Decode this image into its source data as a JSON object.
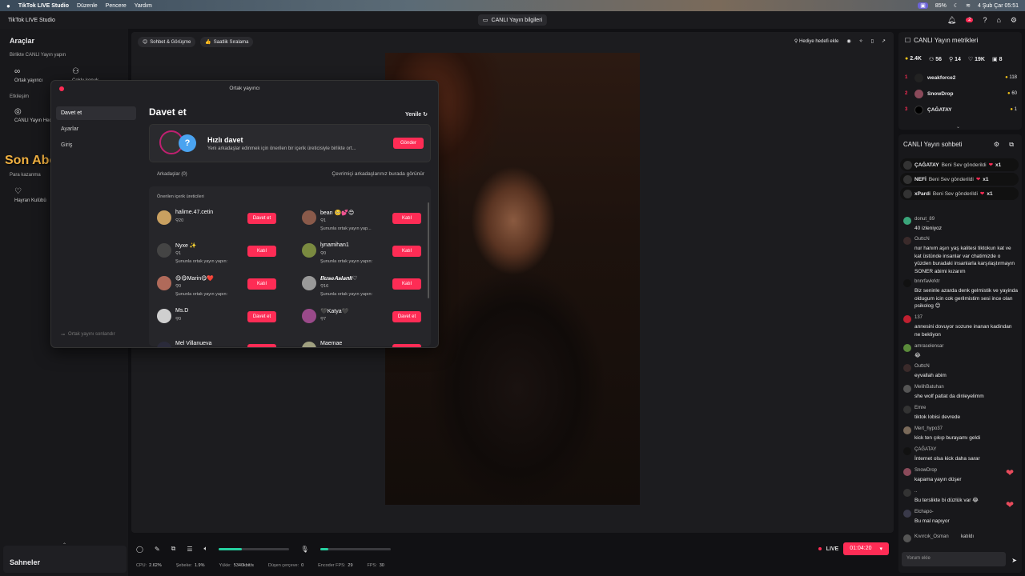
{
  "menubar": {
    "app": "TikTok LIVE Studio",
    "menus": [
      "Düzenle",
      "Pencere",
      "Yardım"
    ],
    "battery": "85%",
    "datetime": "4 Şub Çar  05:51"
  },
  "titlebar": {
    "window_title": "TikTok LIVE Studio",
    "center": "CANLI Yayın bilgileri",
    "notif_count": "2"
  },
  "sidebar": {
    "title": "Araçlar",
    "section1": "Birlikte CANLI Yayın yapın",
    "tool_ortak": "Ortak yayıncı",
    "tool_coklu": "Çoklu konuk",
    "section2": "Etkileşim",
    "tool_canli": "CANLI Yayın Hedefi",
    "section3": "Para kazanma",
    "tool_hayran": "Hayran Kulübü",
    "scenes": "Sahneler"
  },
  "stage": {
    "chip1": "Sohbet & Görüşme",
    "chip2": "Saatlik Sıralama",
    "gift_goal": "Hediye hedefi ekle"
  },
  "overlay": {
    "text": "Son Abone: nicetrydiddyverynice"
  },
  "dialog": {
    "title": "Ortak yayıncı",
    "nav": [
      "Davet et",
      "Ayarlar",
      "Giriş"
    ],
    "footer": "Ortak yayını sonlandır",
    "heading": "Davet et",
    "refresh": "Yenile",
    "quick_title": "Hızlı davet",
    "quick_desc": "Yeni arkadaşlar edinmek için önerilen bir içerik üreticisiyle birlikte ort...",
    "quick_btn": "Gönder",
    "friends_label": "Arkadaşlar (0)",
    "friends_online": "Çevrimiçi arkadaşlarınız burada görünür",
    "suggest_header": "Önerilen içerik üreticileri",
    "creators": [
      {
        "name": "halime.47.cetin",
        "count": "20",
        "sub": "",
        "btn": "Davet et",
        "color": "#c9a060"
      },
      {
        "name": "bean 🥺💕😊",
        "count": "1",
        "sub": "Şununla ortak yayın yap...",
        "btn": "Katıl",
        "color": "#8a5a4a"
      },
      {
        "name": "Nyxe ✨",
        "count": "1",
        "sub": "Şununla ortak yayın yapın:",
        "btn": "Katıl",
        "color": "#444"
      },
      {
        "name": "lynamihan1",
        "count": "0",
        "sub": "Şununla ortak yayın yapın:",
        "btn": "Katıl",
        "color": "#7a8a40"
      },
      {
        "name": "😋😋Marin😋❤️",
        "count": "0",
        "sub": "Şununla ortak yayın yapın:",
        "btn": "Katıl",
        "color": "#b06a5a"
      },
      {
        "name": "𝑩𝒖𝒔𝒆𝑨𝒔𝒍𝒂𝒏𝒍𝒊♡",
        "count": "16",
        "sub": "Şununla ortak yayın yapın:",
        "btn": "Katıl",
        "color": "#999"
      },
      {
        "name": "Ms.D",
        "count": "0",
        "sub": "",
        "btn": "Davet et",
        "color": "#cfcfcf"
      },
      {
        "name": "🖤Katya🖤",
        "count": "7",
        "sub": "",
        "btn": "Davet et",
        "color": "#9a4a8a"
      },
      {
        "name": "Mel Villanueva",
        "count": "0",
        "sub": "",
        "btn": "Davet et",
        "color": "#2a2a3a"
      },
      {
        "name": "Maemae",
        "count": "0",
        "sub": "",
        "btn": "Davet et",
        "color": "#a0a080"
      }
    ]
  },
  "controls": {
    "mic_level": 0.32,
    "volume_level": 0.12,
    "live_label": "LIVE",
    "timer": "01:04:20"
  },
  "status": {
    "cpu_label": "CPU:",
    "cpu": "2.62%",
    "sebeke_label": "Şebeke:",
    "sebeke": "1.9%",
    "yukle_label": "Yükle:",
    "yukle": "5340kbit/s",
    "drop_label": "Düşen çerçeve:",
    "drop": "0",
    "enc_label": "Encoder FPS:",
    "enc": "29",
    "fps_label": "FPS:",
    "fps": "30"
  },
  "metrics": {
    "title": "CANLI Yayın metrikleri",
    "coins": "2.4K",
    "viewers": "56",
    "users": "14",
    "likes": "19K",
    "gifts": "8",
    "leaders": [
      {
        "rank": "1",
        "name": "weakforce2",
        "value": "118"
      },
      {
        "rank": "2",
        "name": "SnowDrop",
        "value": "60"
      },
      {
        "rank": "3",
        "name": "ÇAĞATAY",
        "value": "1"
      }
    ]
  },
  "chat": {
    "title": "CANLI Yayın sohbeti",
    "gifts": [
      {
        "user": "ÇAĞATAY",
        "text": "Beni Sev gönderildi",
        "count": "x1"
      },
      {
        "user": "NEFİ",
        "text": "Beni Sev gönderildi",
        "count": "x1"
      },
      {
        "user": "xPardi",
        "text": "Beni Sev gönderildi",
        "count": "x1"
      }
    ],
    "messages": [
      {
        "user": "donut_89",
        "text": "40 izleniyoz",
        "color": "#3aa57a"
      },
      {
        "user": "OuttcN",
        "text": "nur hanım aşırı yaş kalitesi tiktokun kat ve kat üstünde insanlar var chatimizde o yüzden buradaki insanlarla karşılaştırmayın SONER abimi kızarım",
        "color": "#3a2a2a"
      },
      {
        "user": "bnnrfavkrktr",
        "text": "Biz seninle azarda denk gelmistik ve yayinda oldugum icin cok gerilmistim sesi ince olan psikolog 😊",
        "color": "#111"
      },
      {
        "user": "137",
        "text": "annesini dovuyor sozune inanan kadindan ne bekliyon",
        "color": "#c02030"
      },
      {
        "user": "amraselensar",
        "text": "😂",
        "color": "#5a8a3a"
      },
      {
        "user": "OuttcN",
        "text": "eyvallah abim",
        "color": "#3a2a2a"
      },
      {
        "user": "MelihBatuhan",
        "text": "she wolf patlat da dinleyelimm",
        "color": "#555"
      },
      {
        "user": "Emre",
        "text": "tiktok lobisi devrede",
        "color": "#333"
      },
      {
        "user": "Mert_hypo37",
        "text": "kick ten çıkıp burayamı geldi",
        "color": "#7a6a5a"
      },
      {
        "user": "ÇAĞATAY",
        "text": "İnternet olsa kick daha sarar",
        "color": "#111"
      },
      {
        "user": "SnowDrop",
        "text": "kapama yayın düşer",
        "color": "#8a4a5a"
      },
      {
        "user": "..",
        "text": "Bu terslikte bi düzlük var 😂",
        "color": "#333"
      },
      {
        "user": "Elchapo-",
        "text": "Bu mal napıyor",
        "color": "#3a3a4a"
      }
    ],
    "joined_user": "Kıvırcık_Osman",
    "joined_text": "katıldı",
    "input_placeholder": "Yorum ekle"
  }
}
